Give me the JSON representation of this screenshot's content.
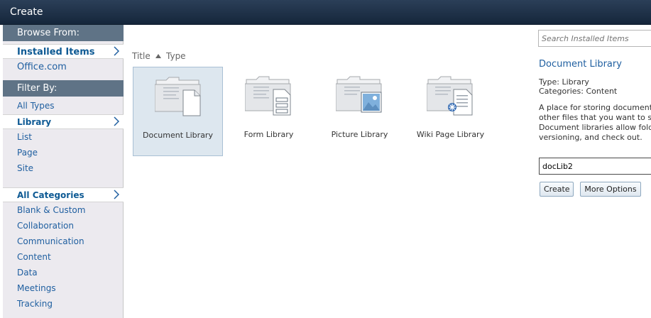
{
  "window": {
    "title": "Create"
  },
  "sidebar": {
    "browse_heading": "Browse From:",
    "browse_items": [
      {
        "label": "Installed Items",
        "selected": true
      },
      {
        "label": "Office.com",
        "selected": false
      }
    ],
    "filter_heading": "Filter By:",
    "type_items": [
      {
        "label": "All Types",
        "selected": false
      },
      {
        "label": "Library",
        "selected": true
      },
      {
        "label": "List",
        "selected": false
      },
      {
        "label": "Page",
        "selected": false
      },
      {
        "label": "Site",
        "selected": false
      }
    ],
    "category_items": [
      {
        "label": "All Categories",
        "selected": true
      },
      {
        "label": "Blank & Custom",
        "selected": false
      },
      {
        "label": "Collaboration",
        "selected": false
      },
      {
        "label": "Communication",
        "selected": false
      },
      {
        "label": "Content",
        "selected": false
      },
      {
        "label": "Data",
        "selected": false
      },
      {
        "label": "Meetings",
        "selected": false
      },
      {
        "label": "Tracking",
        "selected": false
      }
    ]
  },
  "main": {
    "sort": {
      "title_label": "Title",
      "type_label": "Type"
    },
    "tiles": [
      {
        "label": "Document Library",
        "icon": "document-library-icon",
        "selected": true
      },
      {
        "label": "Form Library",
        "icon": "form-library-icon",
        "selected": false
      },
      {
        "label": "Picture Library",
        "icon": "picture-library-icon",
        "selected": false
      },
      {
        "label": "Wiki Page Library",
        "icon": "wiki-page-library-icon",
        "selected": false
      }
    ]
  },
  "details": {
    "search_placeholder": "Search Installed Items",
    "title": "Document Library",
    "type_line": "Type: Library",
    "categories_line": "Categories: Content",
    "description": "A place for storing documents or other files that you want to share. Document libraries allow folders, versioning, and check out.",
    "name_value": "docLib2",
    "create_label": "Create",
    "more_options_label": "More Options"
  },
  "colors": {
    "title_bar": "#1c2e45",
    "heading_bar": "#5f7386",
    "link": "#1f5fa0",
    "selected_tile": "#dde7ef"
  }
}
